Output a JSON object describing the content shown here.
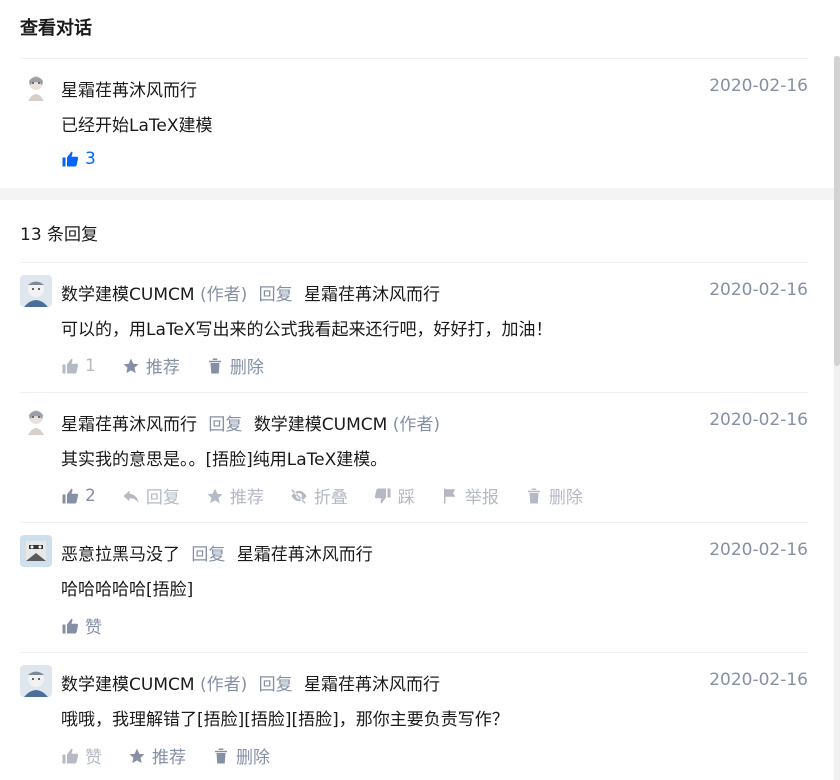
{
  "header": {
    "title": "查看对话"
  },
  "main_comment": {
    "author": "星霜荏苒沐风而行",
    "date": "2020-02-16",
    "content": "已经开始LaTeX建模",
    "likes": "3"
  },
  "replies_title": "13 条回复",
  "labels": {
    "reply": "回复",
    "author_tag": "(作者)",
    "recommend": "推荐",
    "delete": "删除",
    "collapse": "折叠",
    "dislike": "踩",
    "report": "举报",
    "like": "赞"
  },
  "replies": [
    {
      "author": "数学建模CUMCM",
      "target": "星霜荏苒沐风而行",
      "date": "2020-02-16",
      "content": "可以的，用LaTeX写出来的公式我看起来还行吧，好好打，加油！",
      "likes": "1"
    },
    {
      "author": "星霜荏苒沐风而行",
      "target": "数学建模CUMCM",
      "date": "2020-02-16",
      "content": "其实我的意思是。。[捂脸]纯用LaTeX建模。",
      "likes": "2"
    },
    {
      "author": "恶意拉黑马没了",
      "target": "星霜荏苒沐风而行",
      "date": "2020-02-16",
      "content": "哈哈哈哈哈[捂脸]"
    },
    {
      "author": "数学建模CUMCM",
      "target": "星霜荏苒沐风而行",
      "date": "2020-02-16",
      "content": "哦哦，我理解错了[捂脸][捂脸][捂脸]，那你主要负责写作？"
    }
  ],
  "colors": {
    "accent": "#0066ff",
    "muted": "#8590a6",
    "divider": "#f4f4f5"
  }
}
